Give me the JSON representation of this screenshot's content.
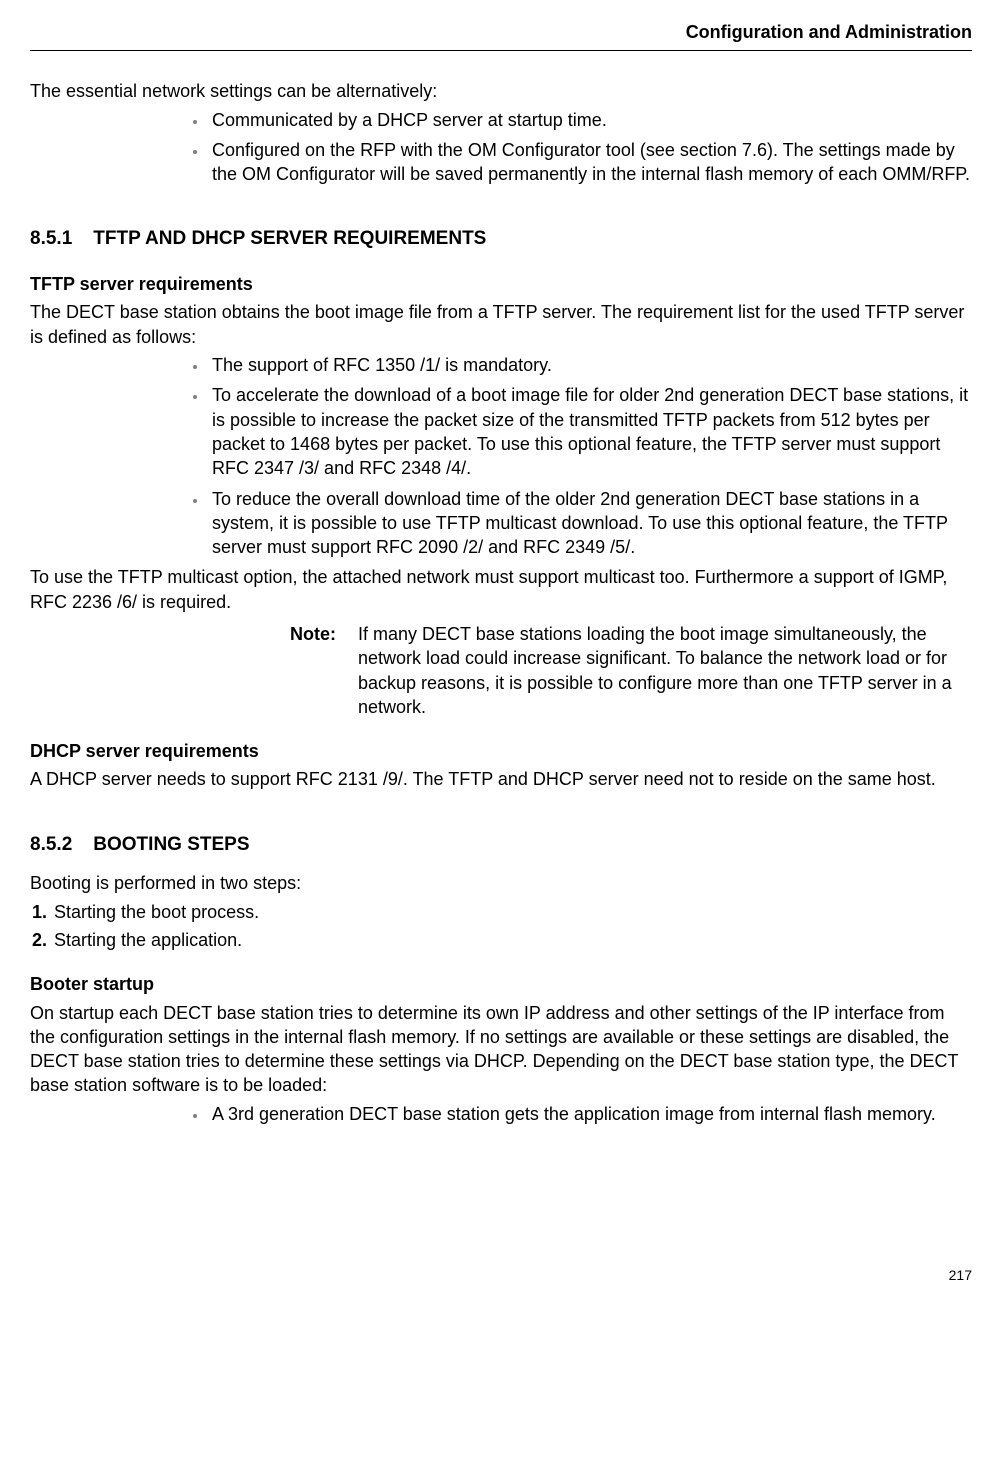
{
  "header": {
    "title": "Configuration and Administration"
  },
  "intro": {
    "text": "The essential network settings can be alternatively:",
    "bullets": [
      "Communicated by a DHCP server at startup time.",
      "Configured on the RFP with the OM Configurator tool (see section 7.6). The settings made by the OM Configurator will be saved permanently in the internal flash memory of each OMM/RFP."
    ]
  },
  "section_851": {
    "number": "8.5.1",
    "title": "TFTP AND DHCP SERVER REQUIREMENTS",
    "tftp_heading": "TFTP server requirements",
    "tftp_intro": "The DECT base station obtains the boot image file from a TFTP server. The requirement list for the used TFTP server is defined as follows:",
    "tftp_bullets": [
      "The support of RFC 1350 /1/ is mandatory.",
      "To accelerate the download of a boot image file for older 2nd generation DECT base stations, it is possible to increase the packet size of the transmitted TFTP packets from 512 bytes per packet to 1468 bytes per packet. To use this optional feature, the TFTP server must support RFC 2347 /3/ and RFC 2348 /4/.",
      "To reduce the overall download time of the older 2nd generation DECT base stations in a system, it is possible to use TFTP multicast download. To use this optional feature, the TFTP server must support RFC 2090 /2/ and RFC 2349 /5/."
    ],
    "tftp_after": "To use the TFTP multicast option, the attached network must support multicast too. Furthermore a support of IGMP, RFC 2236 /6/ is required.",
    "note_label": "Note:",
    "note_text": "If many DECT base stations loading the boot image simultaneously, the network load could increase significant. To balance the network load or for backup reasons, it is possible to configure more than one TFTP server in a network.",
    "dhcp_heading": "DHCP server requirements",
    "dhcp_text": "A DHCP server needs to support RFC 2131 /9/. The TFTP and DHCP server need not to reside on the same host."
  },
  "section_852": {
    "number": "8.5.2",
    "title": "BOOTING STEPS",
    "intro": "Booting is performed in two steps:",
    "steps": [
      "Starting the boot process.",
      "Starting the application."
    ],
    "booter_heading": "Booter startup",
    "booter_text": "On startup each DECT base station tries to determine its own IP address and other settings of the IP interface from the configuration settings in the internal flash memory. If no settings are available or these settings are disabled, the DECT base station tries to determine these settings via DHCP. Depending on the DECT base station type, the DECT base station software is to be loaded:",
    "booter_bullets": [
      "A 3rd generation DECT base station gets the application image from internal flash memory."
    ]
  },
  "page_number": "217"
}
